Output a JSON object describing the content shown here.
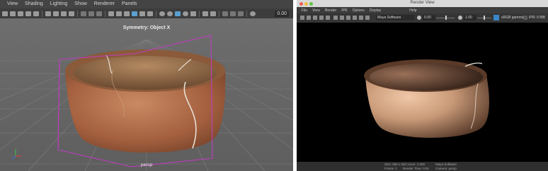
{
  "left_panel": {
    "menu": [
      "View",
      "Shading",
      "Lighting",
      "Show",
      "Renderer",
      "Panels"
    ],
    "toolbar_value": "0.00",
    "symmetry_label": "Symmetry: Object X",
    "camera_label": "persp"
  },
  "render_view": {
    "window_title": "Render View",
    "menu": [
      "File",
      "View",
      "Render",
      "IPR",
      "Options",
      "Display",
      "Help"
    ],
    "renderer_select": "Maya Software",
    "exposure_value": "0.00",
    "gamma_value": "1.00",
    "colorspace_label": "sRGB gamma",
    "ipr_label": "IPR: 0 MB",
    "status": {
      "size": "Size: 960 x 540 zoom: 1.000",
      "renderer": "Maya Software",
      "frame": "Frame: 1",
      "render_time": "Render Time: 0:01",
      "camera": "Camera: persp"
    }
  },
  "colors": {
    "maya_viewport_bg": "#6a6a6a",
    "maya_menu_bg": "#444444",
    "selection_magenta": "#c03cc0",
    "render_bg": "#000000",
    "bowl_terracotta": "#a86a48"
  }
}
